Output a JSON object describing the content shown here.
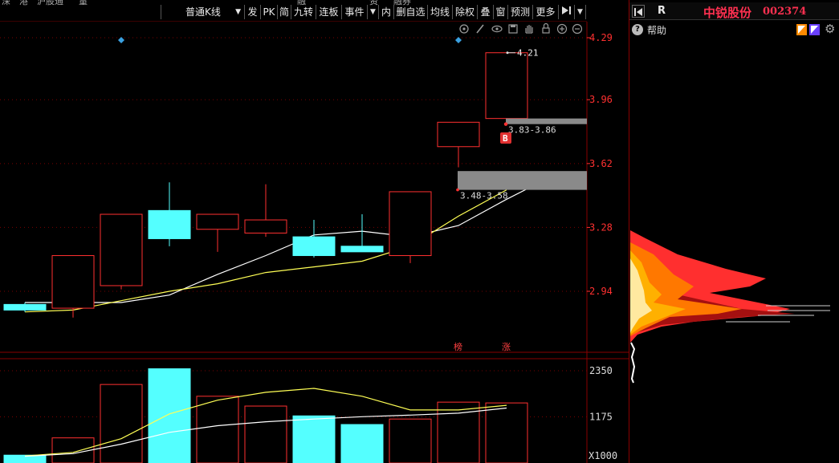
{
  "toolbar": {
    "top_fragments": [
      "深",
      "港",
      "沪股通",
      "量",
      "融",
      "资",
      "融券"
    ],
    "chart_type": "普通K线",
    "buttons": [
      "发",
      "PK",
      "简",
      "九转",
      "连板",
      "事件",
      "内",
      "删自选",
      "均线",
      "除权",
      "叠",
      "窗",
      "预测",
      "更多"
    ]
  },
  "stock": {
    "name": "中锐股份",
    "code": "002374",
    "right_flag": "R",
    "help_label": "帮助"
  },
  "colors": {
    "up": "#ff3030",
    "down": "#54ffff",
    "ma_short": "#ffffff",
    "ma_long": "#ffff55",
    "grid": "#7a0000",
    "accent": "#ff4060"
  },
  "chart_data": {
    "type": "candlestick",
    "price_axis": {
      "ticks": [
        4.29,
        3.96,
        3.62,
        3.28,
        2.94
      ],
      "range": [
        2.6,
        4.3
      ]
    },
    "candles": [
      {
        "open": 2.87,
        "close": 2.84,
        "high": 2.88,
        "low": 2.83
      },
      {
        "open": 2.85,
        "close": 3.13,
        "high": 3.13,
        "low": 2.8
      },
      {
        "open": 2.97,
        "close": 3.35,
        "high": 3.35,
        "low": 2.95
      },
      {
        "open": 3.37,
        "close": 3.22,
        "high": 3.52,
        "low": 3.18
      },
      {
        "open": 3.27,
        "close": 3.35,
        "high": 3.35,
        "low": 3.15
      },
      {
        "open": 3.25,
        "close": 3.32,
        "high": 3.51,
        "low": 3.23
      },
      {
        "open": 3.23,
        "close": 3.13,
        "high": 3.32,
        "low": 3.12
      },
      {
        "open": 3.18,
        "close": 3.15,
        "high": 3.35,
        "low": 3.15
      },
      {
        "open": 3.13,
        "close": 3.47,
        "high": 3.47,
        "low": 3.09
      },
      {
        "open": 3.71,
        "close": 3.84,
        "high": 3.84,
        "low": 3.6
      },
      {
        "open": 3.86,
        "close": 4.21,
        "high": 4.21,
        "low": 3.86
      }
    ],
    "ma_short": [
      2.88,
      2.88,
      2.92,
      3.03,
      3.13,
      3.24,
      3.26,
      3.23,
      3.29,
      3.43,
      3.56
    ],
    "ma_long": [
      2.83,
      2.84,
      2.89,
      2.94,
      2.98,
      3.04,
      3.07,
      3.1,
      3.18,
      3.34,
      3.48
    ],
    "annotations": {
      "high_label": "4.21",
      "gap_upper_label": "3.83-3.86",
      "gap_lower_label": "3.48-3.58",
      "buy_marker": "B",
      "tag_bang": "榜",
      "tag_zhang": "涨"
    },
    "volume": {
      "unit_label": "X1000",
      "ticks": [
        2350,
        1175
      ],
      "values": [
        200,
        640,
        2000,
        2400,
        1700,
        1450,
        1200,
        980,
        1120,
        1550,
        1530
      ],
      "ma_short": [
        180,
        270,
        620,
        1250,
        1600,
        1800,
        1900,
        1700,
        1350,
        1350,
        1470
      ],
      "ma_long": [
        170,
        240,
        480,
        780,
        950,
        1050,
        1120,
        1180,
        1220,
        1270,
        1400
      ],
      "range": [
        0,
        2700
      ]
    }
  }
}
